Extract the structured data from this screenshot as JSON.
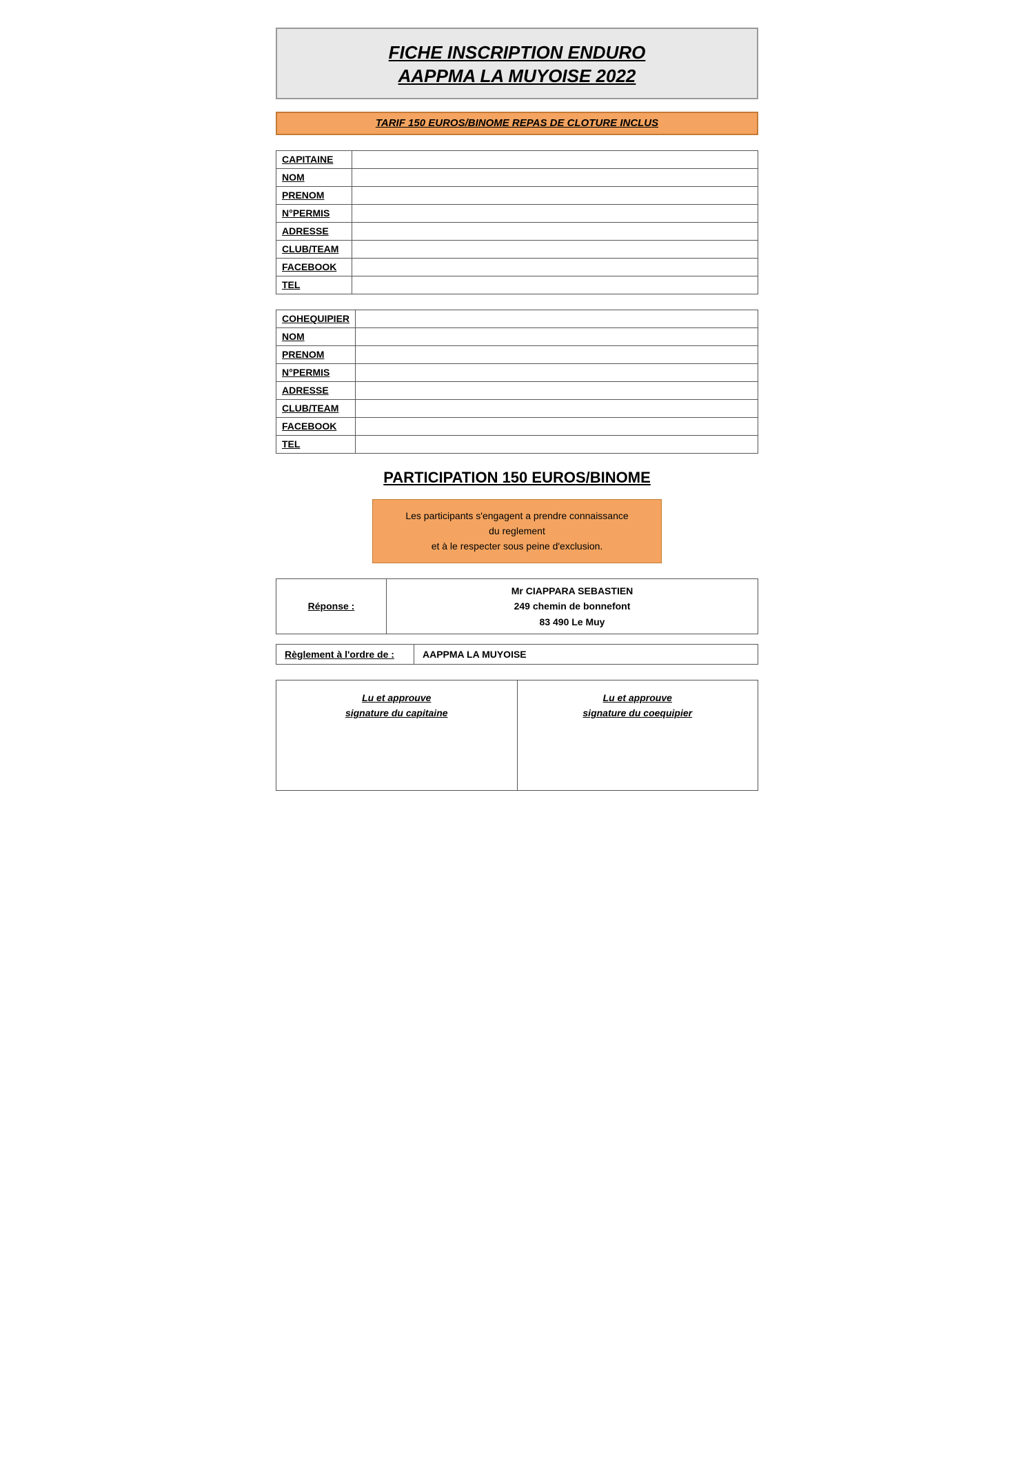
{
  "title": {
    "line1": "FICHE INSCRIPTION ENDURO",
    "line2": "AAPPMA LA MUYOISE 2022"
  },
  "tarif_band": "TARIF 150 EUROS/BINOME REPAS DE CLOTURE INCLUS",
  "capitaine": {
    "header": "CAPITAINE",
    "fields": [
      {
        "label": "NOM",
        "value": ""
      },
      {
        "label": "PRENOM",
        "value": ""
      },
      {
        "label": "N°PERMIS",
        "value": ""
      },
      {
        "label": "ADRESSE",
        "value": ""
      },
      {
        "label": "CLUB/TEAM",
        "value": ""
      },
      {
        "label": "FACEBOOK",
        "value": ""
      },
      {
        "label": "TEL",
        "value": ""
      }
    ]
  },
  "cohequipier": {
    "header": "COHEQUIPIER",
    "fields": [
      {
        "label": "NOM",
        "value": ""
      },
      {
        "label": "PRENOM",
        "value": ""
      },
      {
        "label": "N°PERMIS",
        "value": ""
      },
      {
        "label": "ADRESSE",
        "value": ""
      },
      {
        "label": "CLUB/TEAM",
        "value": ""
      },
      {
        "label": "FACEBOOK",
        "value": ""
      },
      {
        "label": "TEL",
        "value": ""
      }
    ]
  },
  "participation_heading": "PARTICIPATION 150 EUROS/BINOME",
  "rules": {
    "line1": "Les participants s'engagent a prendre connaissance",
    "line2": "du reglement",
    "line3": "et à le respecter sous peine d'exclusion."
  },
  "response": {
    "label": "Réponse :",
    "value_line1": "Mr CIAPPARA SEBASTIEN",
    "value_line2": "249 chemin de bonnefont",
    "value_line3": "83 490 Le Muy"
  },
  "reglement": {
    "label": "Règlement à l'ordre de :",
    "value": "AAPPMA LA MUYOISE"
  },
  "signatures": {
    "capitaine_line1": "Lu et approuve",
    "capitaine_line2": "signature du capitaine",
    "coequipier_line1": "Lu et approuve",
    "coequipier_line2": "signature du coequipier"
  }
}
